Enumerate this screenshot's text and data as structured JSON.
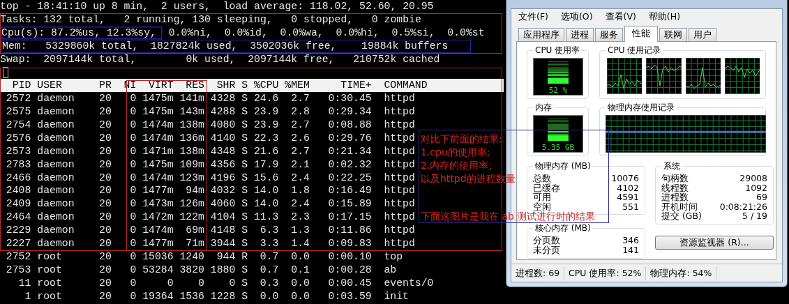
{
  "terminal": {
    "summary_lines": [
      "top - 18:41:10 up 8 min,  2 users,  load average: 118.02, 52.60, 20.95",
      "Tasks: 132 total,   2 running, 130 sleeping,   0 stopped,   0 zombie",
      "Cpu(s): 87.2%us, 12.3%sy,  0.0%ni,  0.0%id,  0.0%wa,  0.0%hi,  0.5%si,  0.0%st",
      "Mem:   5329860k total,  1827824k used,  3502036k free,    19884k buffers",
      "Swap:  2097144k total,        0k used,  2097144k free,   210752k cached"
    ],
    "process_table": {
      "columns": [
        "PID",
        "USER",
        "PR",
        "NI",
        "VIRT",
        "RES",
        "SHR",
        "S",
        "%CPU",
        "%MEM",
        "TIME+",
        "COMMAND"
      ],
      "rows": [
        [
          "2572",
          "daemon",
          "20",
          "0",
          "1475m",
          "141m",
          "4328",
          "S",
          "24.6",
          "2.7",
          "0:30.45",
          "httpd"
        ],
        [
          "2575",
          "daemon",
          "20",
          "0",
          "1475m",
          "143m",
          "4288",
          "S",
          "23.9",
          "2.8",
          "0:29.34",
          "httpd"
        ],
        [
          "2754",
          "daemon",
          "20",
          "0",
          "1474m",
          "138m",
          "4080",
          "S",
          "23.9",
          "2.7",
          "0:08.88",
          "httpd"
        ],
        [
          "2576",
          "daemon",
          "20",
          "0",
          "1474m",
          "136m",
          "4140",
          "S",
          "22.3",
          "2.6",
          "0:29.76",
          "httpd"
        ],
        [
          "2573",
          "daemon",
          "20",
          "0",
          "1471m",
          "138m",
          "4348",
          "S",
          "21.6",
          "2.7",
          "0:21.34",
          "httpd"
        ],
        [
          "2783",
          "daemon",
          "20",
          "0",
          "1475m",
          "109m",
          "4356",
          "S",
          "17.9",
          "2.1",
          "0:02.32",
          "httpd"
        ],
        [
          "2466",
          "daemon",
          "20",
          "0",
          "1474m",
          "123m",
          "4196",
          "S",
          "15.6",
          "2.4",
          "0:22.25",
          "httpd"
        ],
        [
          "2408",
          "daemon",
          "20",
          "0",
          "1477m",
          "94m",
          "4032",
          "S",
          "14.0",
          "1.8",
          "0:16.49",
          "httpd"
        ],
        [
          "2409",
          "daemon",
          "20",
          "0",
          "1473m",
          "126m",
          "4060",
          "S",
          "14.0",
          "2.4",
          "0:15.89",
          "httpd"
        ],
        [
          "2464",
          "daemon",
          "20",
          "0",
          "1472m",
          "122m",
          "4104",
          "S",
          "11.3",
          "2.3",
          "0:17.15",
          "httpd"
        ],
        [
          "2229",
          "daemon",
          "20",
          "0",
          "1474m",
          "69m",
          "4148",
          "S",
          "6.3",
          "1.3",
          "0:11.86",
          "httpd"
        ],
        [
          "2227",
          "daemon",
          "20",
          "0",
          "1477m",
          "71m",
          "3944",
          "S",
          "3.3",
          "1.4",
          "0:09.83",
          "httpd"
        ],
        [
          "2752",
          "root",
          "20",
          "0",
          "15036",
          "1240",
          "944",
          "R",
          "0.7",
          "0.0",
          "0:00.10",
          "top"
        ],
        [
          "2753",
          "root",
          "20",
          "0",
          "53284",
          "3820",
          "1880",
          "S",
          "0.7",
          "0.1",
          "0:00.28",
          "ab"
        ],
        [
          "11",
          "root",
          "20",
          "0",
          "0",
          "0",
          "0",
          "S",
          "0.3",
          "0.0",
          "0:00.45",
          "events/0"
        ],
        [
          "1",
          "root",
          "20",
          "0",
          "19364",
          "1536",
          "1228",
          "S",
          "0.0",
          "0.0",
          "0:03.59",
          "init"
        ]
      ]
    }
  },
  "annotation": {
    "lines": [
      "对比下前面的结果:",
      "1.cpu的使用率;",
      "2.内存的使用率;",
      "以及httpd的进程数量",
      "下面这图片是我在 ab 测试进行时的结果"
    ]
  },
  "task_manager": {
    "menu": [
      "文件(F)",
      "选项(O)",
      "查看(V)",
      "帮助(H)"
    ],
    "tabs": [
      {
        "label": "应用程序",
        "selected": false
      },
      {
        "label": "进程",
        "selected": false
      },
      {
        "label": "服务",
        "selected": false
      },
      {
        "label": "性能",
        "selected": true
      },
      {
        "label": "联网",
        "selected": false
      },
      {
        "label": "用户",
        "selected": false
      }
    ],
    "cpu_usage": {
      "title": "CPU 使用率",
      "reading": "52 %",
      "level": 0.52
    },
    "cpu_history": {
      "title": "CPU 使用记录"
    },
    "memory": {
      "title": "内存",
      "reading": "5.35 GB",
      "level": 0.53
    },
    "memory_history": {
      "title": "物理内存使用记录"
    },
    "physical_memory": {
      "title": "物理内存 (MB)",
      "rows": [
        {
          "label": "总数",
          "value": "10076"
        },
        {
          "label": "已缓存",
          "value": "4102"
        },
        {
          "label": "可用",
          "value": "4591"
        },
        {
          "label": "空闲",
          "value": "551"
        }
      ]
    },
    "kernel_memory": {
      "title": "核心内存 (MB)",
      "rows": [
        {
          "label": "分页数",
          "value": "346"
        },
        {
          "label": "未分页",
          "value": "141"
        }
      ]
    },
    "system": {
      "title": "系统",
      "rows": [
        {
          "label": "句柄数",
          "value": "29008"
        },
        {
          "label": "线程数",
          "value": "1092"
        },
        {
          "label": "进程数",
          "value": "69"
        },
        {
          "label": "开机时间",
          "value": "0:08:21:26"
        },
        {
          "label": "提交 (GB)",
          "value": "5 / 19"
        }
      ]
    },
    "resource_monitor_button": "资源监视器 (R)...",
    "status_bar": [
      "进程数: 69",
      "CPU 使用率: 52%",
      "物理内存: 54%"
    ]
  }
}
